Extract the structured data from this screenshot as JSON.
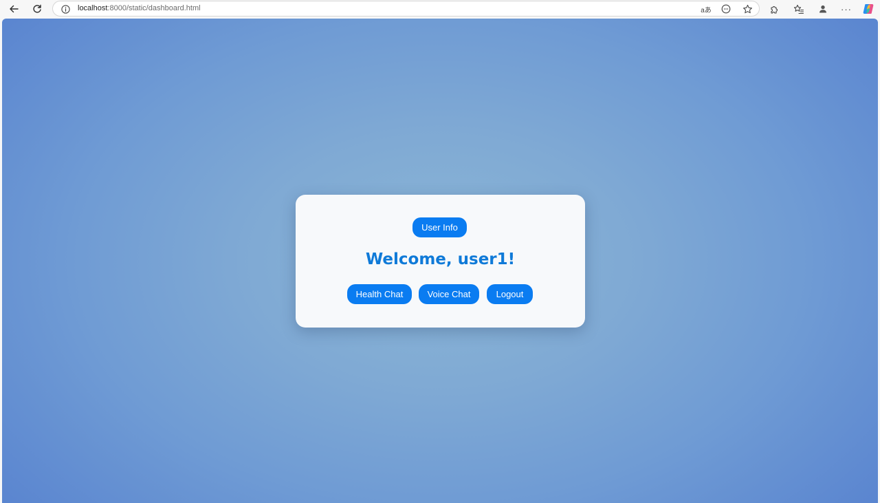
{
  "browser": {
    "url_host": "localhost",
    "url_path": ":8000/static/dashboard.html",
    "read_aloud_label": "aあ",
    "icons": {
      "back": "back-arrow-icon",
      "refresh": "refresh-icon",
      "info": "info-icon",
      "read_aloud": "read-aloud-icon",
      "page_menu": "page-menu-icon",
      "favorite": "star-icon",
      "extensions": "puzzle-icon",
      "favorites": "favorites-icon",
      "profile": "profile-icon",
      "settings": "ellipsis-icon",
      "copilot": "copilot-icon"
    },
    "menu_label": "···"
  },
  "dashboard": {
    "user_info_label": "User Info",
    "welcome_text": "Welcome, user1!",
    "health_chat_label": "Health Chat",
    "voice_chat_label": "Voice Chat",
    "logout_label": "Logout"
  },
  "colors": {
    "button": "#0a7cf1",
    "welcome_text": "#0f7ad8",
    "card": "#f7f9fb",
    "background_center": "#8bb6d6",
    "background_edge": "#5a85d0"
  }
}
